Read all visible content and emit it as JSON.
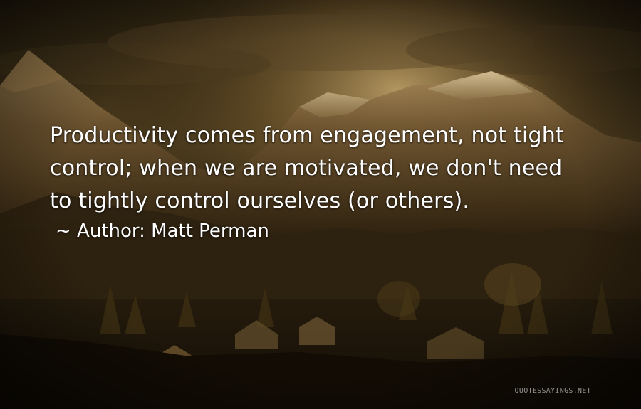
{
  "quote": {
    "lines": [
      "Productivity comes from engagement, not tight",
      "control; when we are motivated, we don't need",
      "to tightly control ourselves (or others)."
    ],
    "author_prefix": "~ Author:",
    "author_name": "Matt Perman"
  },
  "watermark": "QUOTESSAYINGS.NET",
  "colors": {
    "text": "#ffffff",
    "sky_top": "#3b2e16",
    "sky_glow": "#c9a15d",
    "ground": "#120c04"
  }
}
